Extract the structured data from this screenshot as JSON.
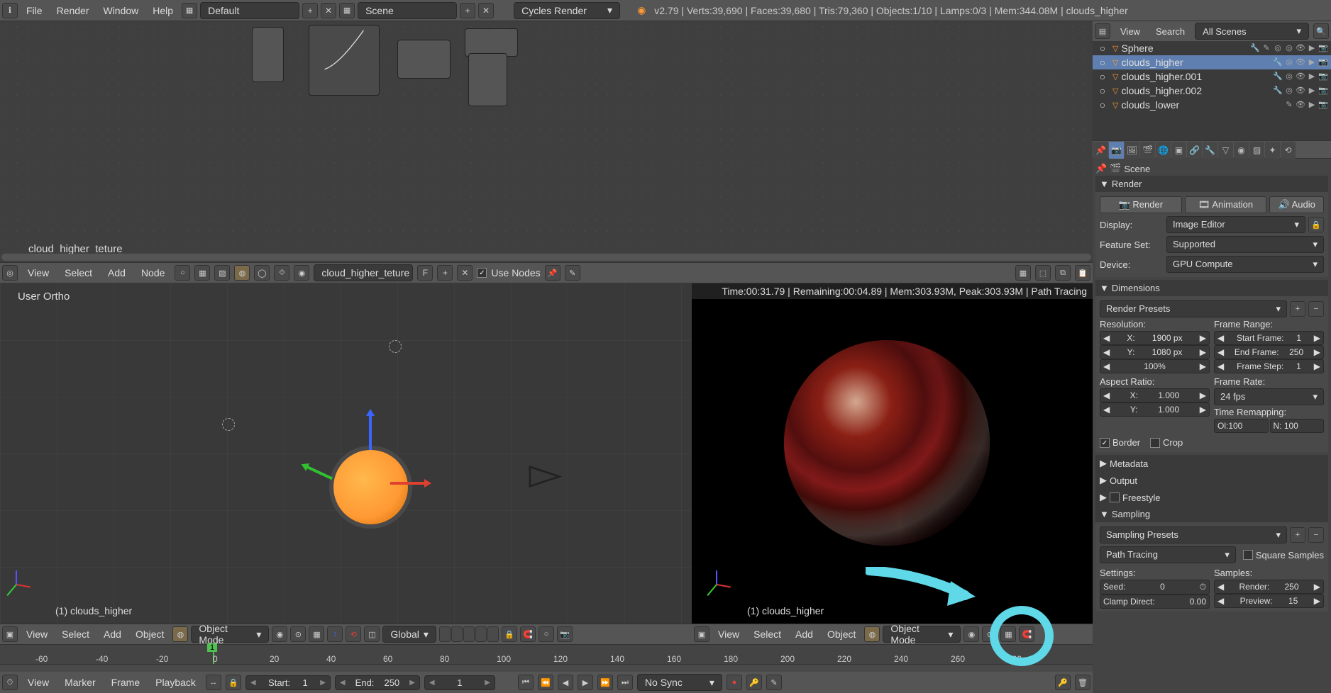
{
  "top": {
    "menu": [
      "File",
      "Render",
      "Window",
      "Help"
    ],
    "layout": "Default",
    "scene": "Scene",
    "engine": "Cycles Render",
    "stats": "v2.79 | Verts:39,690 | Faces:39,680 | Tris:79,360 | Objects:1/10 | Lamps:0/3 | Mem:344.08M | clouds_higher"
  },
  "node_editor": {
    "material_label": "cloud_higher_teture",
    "menu": [
      "View",
      "Select",
      "Add",
      "Node"
    ],
    "material_name": "cloud_higher_teture",
    "fake_user": "F",
    "use_nodes": "Use Nodes"
  },
  "viewport3d": {
    "overlay": "User Ortho",
    "object_label": "(1) clouds_higher",
    "menu": [
      "View",
      "Select",
      "Add",
      "Object"
    ],
    "mode": "Object Mode",
    "orientation": "Global"
  },
  "render_view": {
    "stats": "Time:00:31.79 | Remaining:00:04.89 | Mem:303.93M, Peak:303.93M | Path Tracing",
    "object_label": "(1) clouds_higher",
    "menu": [
      "View",
      "Select",
      "Add",
      "Object"
    ],
    "mode": "Object Mode"
  },
  "timeline": {
    "ticks": [
      "-60",
      "-40",
      "-20",
      "0",
      "20",
      "40",
      "60",
      "80",
      "100",
      "120",
      "140",
      "160",
      "180",
      "200",
      "220",
      "240",
      "260",
      "280"
    ],
    "menu": [
      "View",
      "Marker",
      "Frame",
      "Playback"
    ],
    "start_label": "Start:",
    "start": "1",
    "end_label": "End:",
    "end": "250",
    "current": "1",
    "sync": "No Sync"
  },
  "outliner": {
    "menu": [
      "View",
      "Search"
    ],
    "filter": "All Scenes",
    "items": [
      {
        "name": "Sphere",
        "selected": false
      },
      {
        "name": "clouds_higher",
        "selected": true
      },
      {
        "name": "clouds_higher.001",
        "selected": false
      },
      {
        "name": "clouds_higher.002",
        "selected": false
      },
      {
        "name": "clouds_lower",
        "selected": false
      }
    ]
  },
  "props": {
    "scene_name": "Scene",
    "render": {
      "header": "Render",
      "render_btn": "Render",
      "animation_btn": "Animation",
      "audio_btn": "Audio",
      "display_label": "Display:",
      "display": "Image Editor",
      "feature_label": "Feature Set:",
      "feature": "Supported",
      "device_label": "Device:",
      "device": "GPU Compute"
    },
    "dimensions": {
      "header": "Dimensions",
      "presets": "Render Presets",
      "resolution_label": "Resolution:",
      "x": "1900 px",
      "y": "1080 px",
      "pct": "100%",
      "range_label": "Frame Range:",
      "start": "Start Frame:",
      "start_v": "1",
      "end": "End Frame:",
      "end_v": "250",
      "step": "Frame Step:",
      "step_v": "1",
      "aspect_label": "Aspect Ratio:",
      "ax": "1.000",
      "ay": "1.000",
      "rate_label": "Frame Rate:",
      "rate": "24 fps",
      "remap_label": "Time Remapping:",
      "ol": "Ol:100",
      "nw": "N: 100",
      "border": "Border",
      "crop": "Crop"
    },
    "metadata": "Metadata",
    "output": "Output",
    "freestyle": "Freestyle",
    "sampling": {
      "header": "Sampling",
      "presets": "Sampling Presets",
      "integrator": "Path Tracing",
      "square": "Square Samples",
      "settings_label": "Settings:",
      "seed": "Seed:",
      "seed_v": "0",
      "clamp": "Clamp Direct:",
      "clamp_v": "0.00",
      "samples_label": "Samples:",
      "render": "Render:",
      "render_v": "250",
      "preview": "Preview:",
      "preview_v": "15"
    }
  }
}
